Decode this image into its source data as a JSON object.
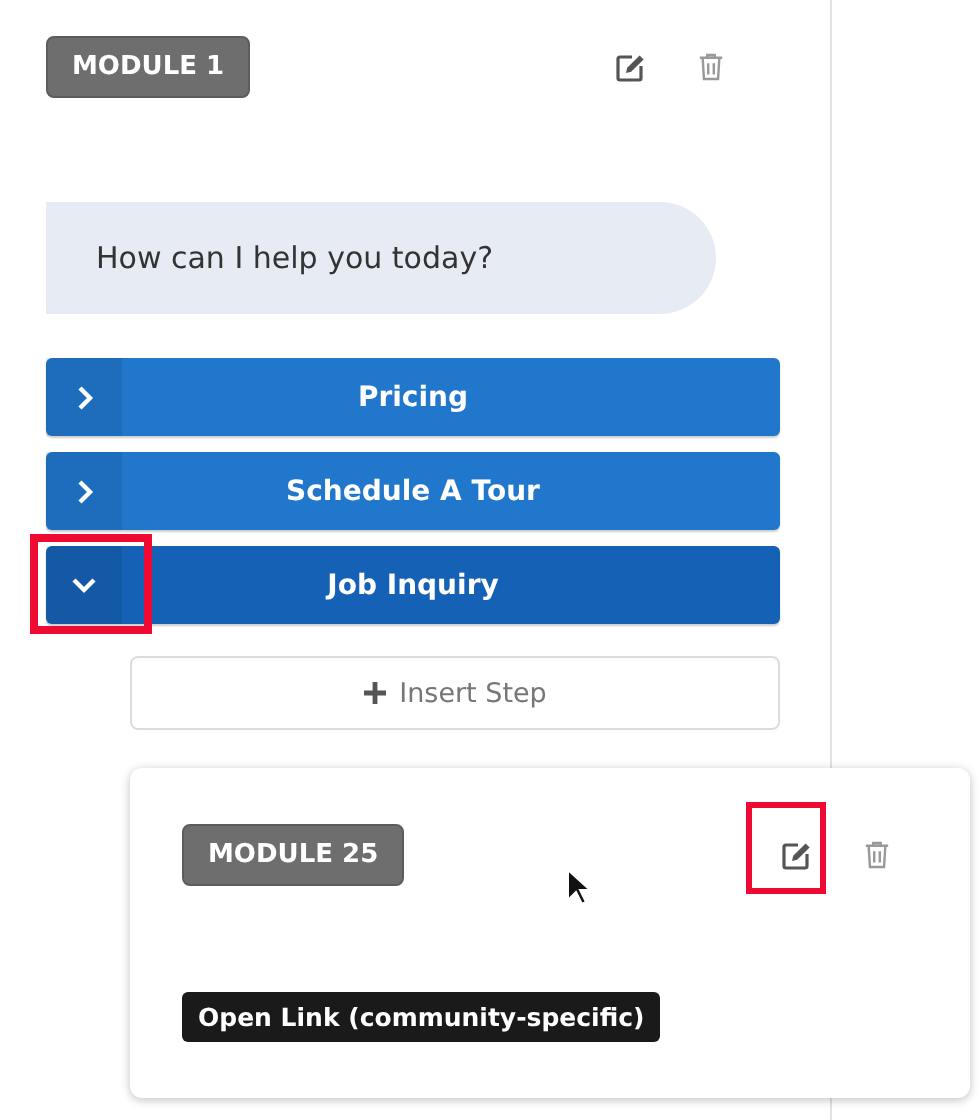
{
  "module": {
    "label": "MODULE 1"
  },
  "message": "How can I help you today?",
  "options": [
    {
      "label": "Pricing",
      "expanded": false,
      "highlighted": false
    },
    {
      "label": "Schedule A Tour",
      "expanded": false,
      "highlighted": false
    },
    {
      "label": "Job Inquiry",
      "expanded": true,
      "highlighted": true
    }
  ],
  "insert_step": {
    "label": "Insert Step"
  },
  "child_module": {
    "label": "MODULE 25",
    "edit_highlighted": true,
    "action_tag": "Open Link (community-specific)"
  }
}
